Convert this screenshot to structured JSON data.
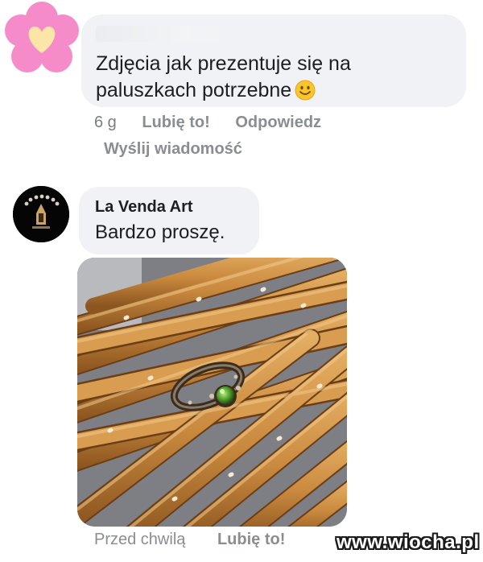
{
  "first_comment": {
    "text": "Zdjęcia jak prezentuje się na paluszkach potrzebne",
    "emoji": "smiling-face-icon",
    "avatar_icon": "flower-heart-icon",
    "avatar_color": "#f58bc8",
    "time": "6 g",
    "like_label": "Lubię to!",
    "reply_label": "Odpowiedz",
    "send_message_label": "Wyślij wiadomość"
  },
  "reply": {
    "author": "La Venda Art",
    "text": "Bardzo proszę.",
    "avatar_icon": "la-venda-art-logo",
    "photo": "ring-on-pretzel-sticks-image",
    "time": "Przed chwilą",
    "like_label": "Lubię to!"
  },
  "watermark": "www.wiocha.pl",
  "colors": {
    "bubble": "#f0f2f5",
    "meta_text": "#8a8d91"
  }
}
